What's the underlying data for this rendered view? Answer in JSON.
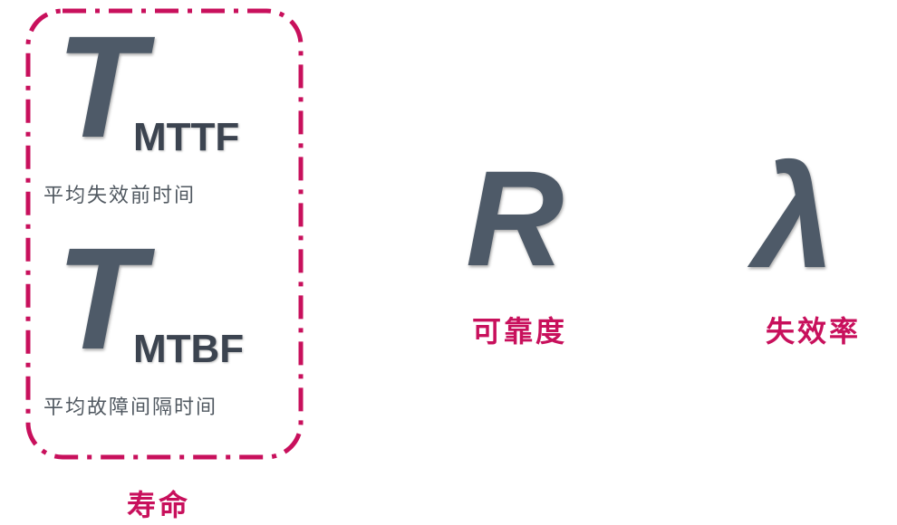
{
  "colors": {
    "accent": "#c8105c",
    "symbol": "#4e5a68",
    "subscript": "#3c4450",
    "description": "#505860"
  },
  "lifetime_group": {
    "mttf": {
      "symbol": "T",
      "subscript": "MTTF",
      "description": "平均失效前时间"
    },
    "mtbf": {
      "symbol": "T",
      "subscript": "MTBF",
      "description": "平均故障间隔时间"
    },
    "label": "寿命"
  },
  "reliability": {
    "symbol": "R",
    "label": "可靠度"
  },
  "failure_rate": {
    "symbol": "λ",
    "label": "失效率"
  }
}
